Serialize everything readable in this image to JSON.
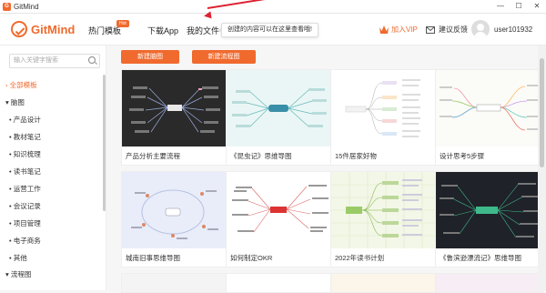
{
  "window": {
    "app_title": "GitMind",
    "controls": {
      "minimize": "—",
      "maximize": "☐",
      "close": "✕"
    }
  },
  "header": {
    "brand": "GitMind",
    "nav": {
      "templates": "热门模板",
      "hot_badge": "Hot",
      "download": "下载App",
      "my_files": "我的文件"
    },
    "tooltip": "创建的内容可以在这里查看哦!",
    "vip": "加入VIP",
    "feedback": "建议反馈",
    "username": "user101932"
  },
  "sidebar": {
    "search_placeholder": "输入关键字搜索",
    "items": {
      "all": "全部模板",
      "mindmap": "脑图",
      "product": "产品设计",
      "notes": "教材笔记",
      "knowledge": "知识梳理",
      "reading": "读书笔记",
      "work": "运营工作",
      "meeting": "会议记录",
      "project": "项目管理",
      "ecommerce": "电子商务",
      "other": "其他",
      "flowchart": "流程图"
    }
  },
  "buttons": {
    "new_mindmap": "新建脑图",
    "new_flowchart": "新建流程图"
  },
  "cards": {
    "c1": "产品分析主要流程",
    "c2": "《昆虫记》思维导图",
    "c3": "15件居家好物",
    "c4": "设计思考5步骤",
    "c5": "城南旧事思维导图",
    "c6": "如何制定OKR",
    "c7": "2022年读书计划",
    "c8": "《鲁滨逊漂流记》思维导图"
  },
  "colors": {
    "accent": "#f06a2e",
    "annotation_arrow": "#dd2233"
  }
}
